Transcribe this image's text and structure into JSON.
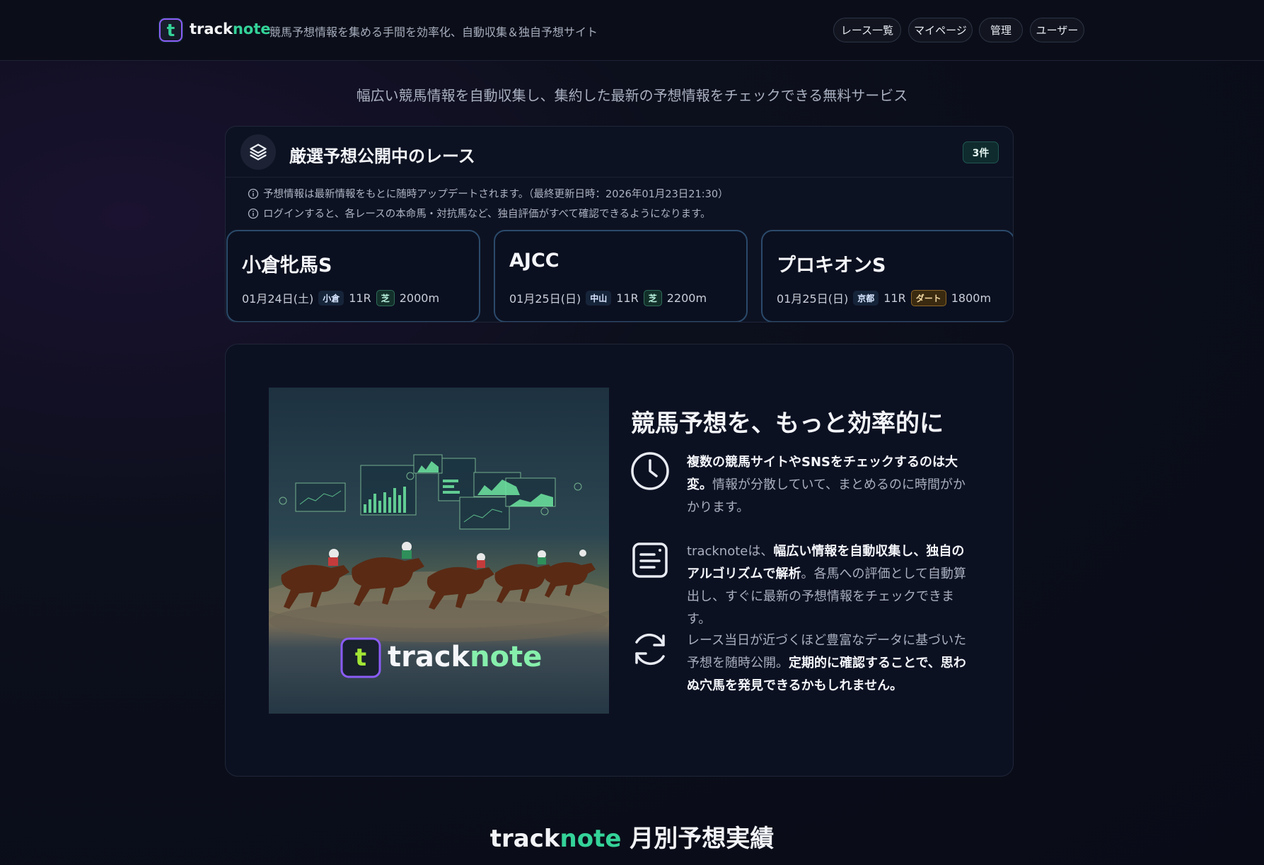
{
  "header": {
    "logo_letter": "t",
    "brand_part1": "track",
    "brand_part2": "note",
    "tagline": "競馬予想情報を集める手間を効率化、自動収集＆独自予想サイト",
    "nav": [
      {
        "label": "レース一覧"
      },
      {
        "label": "マイページ"
      },
      {
        "label": "管理"
      },
      {
        "label": "ユーザー"
      }
    ]
  },
  "hero": {
    "text": "幅広い競馬情報を自動収集し、集約した最新の予想情報をチェックできる無料サービス"
  },
  "featured": {
    "title": "厳選予想公開中のレース",
    "count": "3件",
    "notes": [
      "予想情報は最新情報をもとに随時アップデートされます。（最終更新日時：2026年01月23日21:30）",
      "ログインすると、各レースの本命馬・対抗馬など、独自評価がすべて確認できるようになります。"
    ],
    "races": [
      {
        "name": "小倉牝馬S",
        "date": "01月24日(土)",
        "course": "小倉",
        "race_no": "11R",
        "surface": "芝",
        "distance": "2000m"
      },
      {
        "name": "AJCC",
        "date": "01月25日(日)",
        "course": "中山",
        "race_no": "11R",
        "surface": "芝",
        "distance": "2200m"
      },
      {
        "name": "プロキオンS",
        "date": "01月25日(日)",
        "course": "京都",
        "race_no": "11R",
        "surface": "ダート",
        "distance": "1800m"
      }
    ]
  },
  "info": {
    "image_logo_letter": "t",
    "image_brand_part1": "track",
    "image_brand_part2": "note",
    "title": "競馬予想を、もっと効率的に",
    "features": [
      {
        "icon": "clock-icon",
        "bold_lead": "複数の競馬サイトやSNSをチェックするのは大変。",
        "text": "情報が分散していて、まとめるのに時間がかかります。"
      },
      {
        "icon": "document-icon",
        "lead": "tracknoteは、",
        "bold": "幅広い情報を自動収集し、独自のアルゴリズムで解析",
        "text": "。各馬への評価として自動算出し、すぐに最新の予想情報をチェックできます。"
      },
      {
        "icon": "refresh-icon",
        "lead": "レース当日が近づくほど豊富なデータに基づいた予想を随時公開。",
        "bold": "定期的に確認することで、思わぬ穴馬を発見できるかもしれません。"
      }
    ]
  },
  "monthly": {
    "brand_part1": "track",
    "brand_part2": "note",
    "title": "月別予想実績"
  },
  "colors": {
    "accent_green": "#34d399",
    "accent_purple": "#8b5cf6",
    "background": "#0b0e19"
  }
}
